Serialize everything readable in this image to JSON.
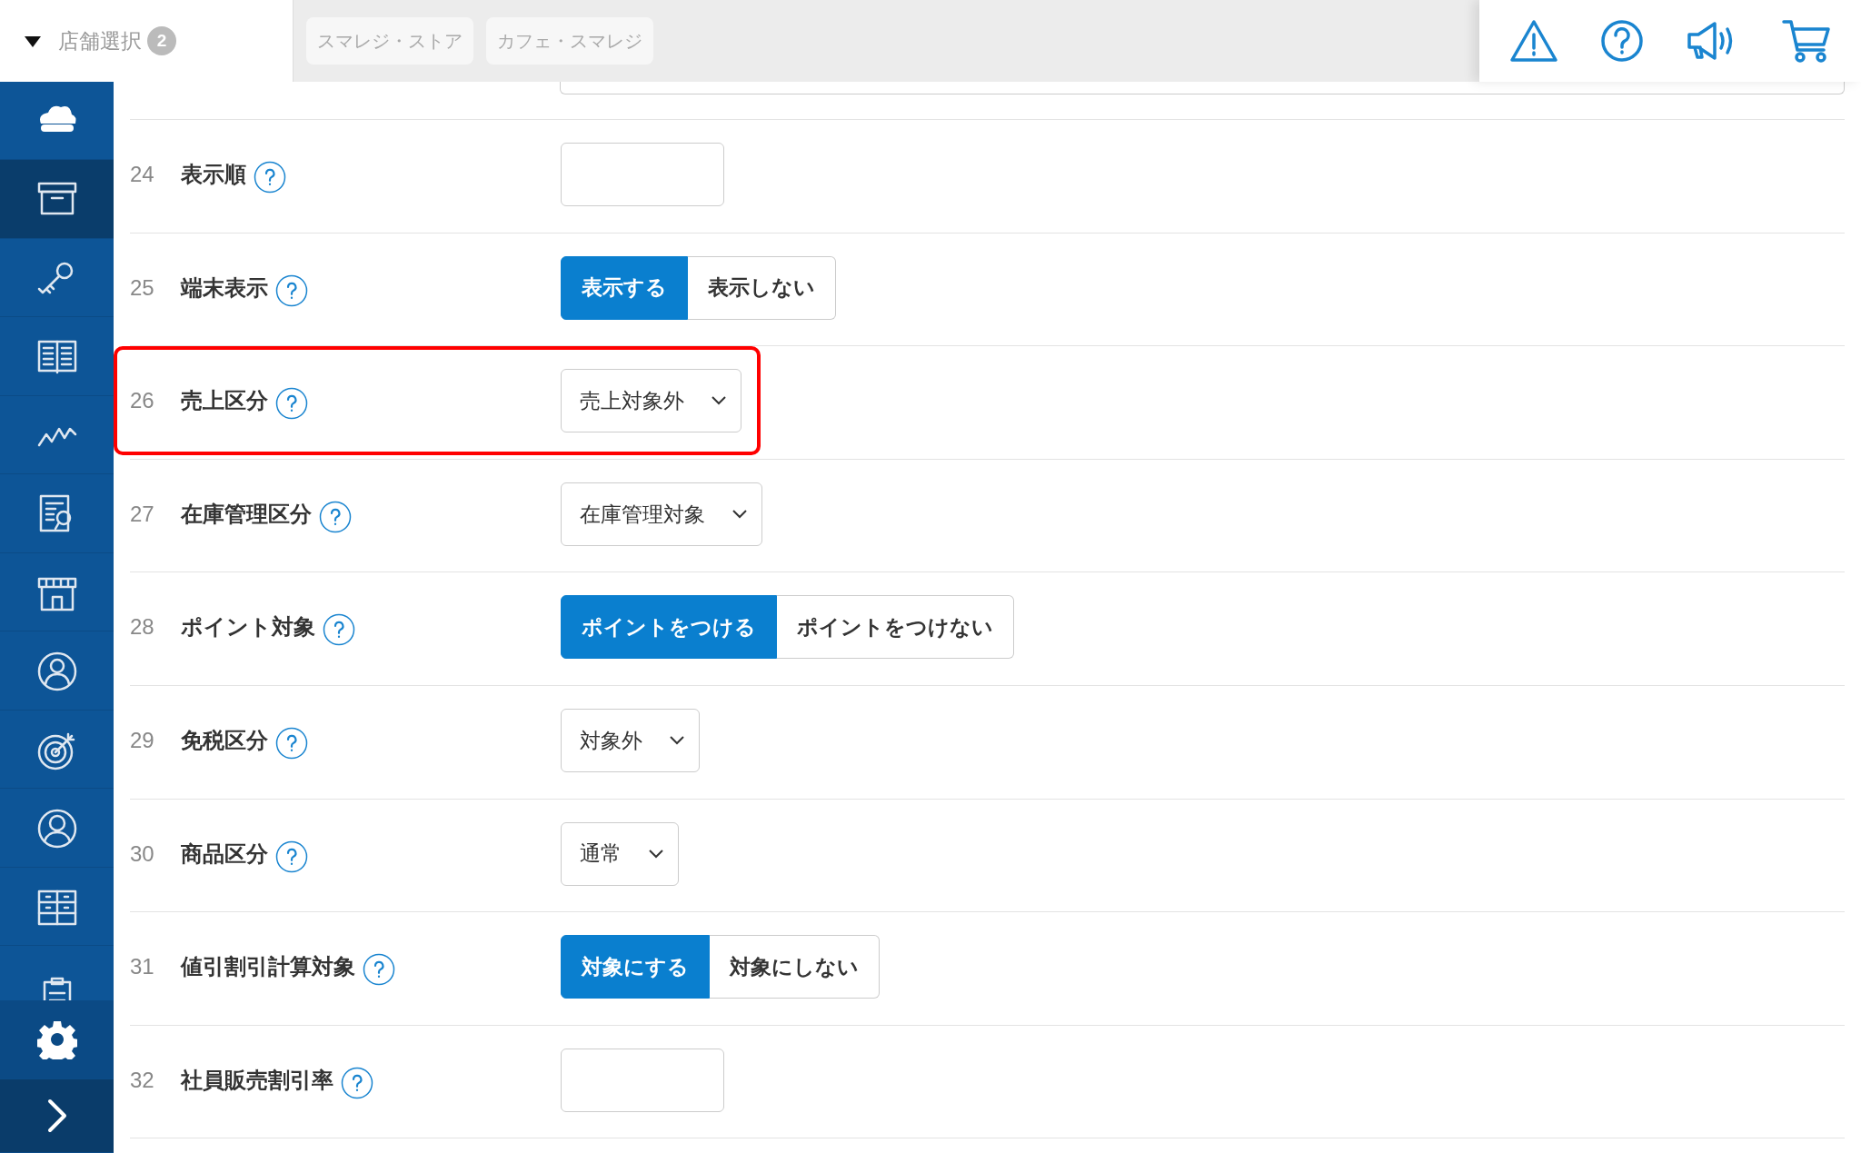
{
  "header": {
    "store_select": {
      "label": "店舗選択",
      "count": "2",
      "expanded": true
    },
    "store_tabs": [
      "スマレジ・ストア",
      "カフェ・スマレジ"
    ]
  },
  "sidebar": {
    "items": [
      {
        "selected": false
      },
      {
        "selected": true
      },
      {
        "selected": false
      },
      {
        "selected": false
      },
      {
        "selected": false
      },
      {
        "selected": false
      },
      {
        "selected": false
      },
      {
        "selected": false
      },
      {
        "selected": false
      },
      {
        "selected": false
      },
      {
        "selected": false
      },
      {
        "selected": false
      }
    ]
  },
  "form": {
    "rows": [
      {
        "number": "24",
        "label": "表示順",
        "kind": "input",
        "value": "",
        "highlighted": false
      },
      {
        "number": "25",
        "label": "端末表示",
        "kind": "toggle",
        "highlighted": false,
        "options": [
          {
            "label": "表示する",
            "selected": true
          },
          {
            "label": "表示しない",
            "selected": false
          }
        ]
      },
      {
        "number": "26",
        "label": "売上区分",
        "kind": "select",
        "value": "売上対象外",
        "highlighted": true
      },
      {
        "number": "27",
        "label": "在庫管理区分",
        "kind": "select",
        "value": "在庫管理対象",
        "highlighted": false
      },
      {
        "number": "28",
        "label": "ポイント対象",
        "kind": "toggle",
        "highlighted": false,
        "options": [
          {
            "label": "ポイントをつける",
            "selected": true
          },
          {
            "label": "ポイントをつけない",
            "selected": false
          }
        ]
      },
      {
        "number": "29",
        "label": "免税区分",
        "kind": "select",
        "value": "対象外",
        "highlighted": false
      },
      {
        "number": "30",
        "label": "商品区分",
        "kind": "select",
        "value": "通常",
        "highlighted": false
      },
      {
        "number": "31",
        "label": "値引割引計算対象",
        "kind": "toggle",
        "highlighted": false,
        "options": [
          {
            "label": "対象にする",
            "selected": true
          },
          {
            "label": "対象にしない",
            "selected": false
          }
        ]
      },
      {
        "number": "32",
        "label": "社員販売割引率",
        "kind": "input",
        "value": "",
        "highlighted": false
      }
    ]
  }
}
